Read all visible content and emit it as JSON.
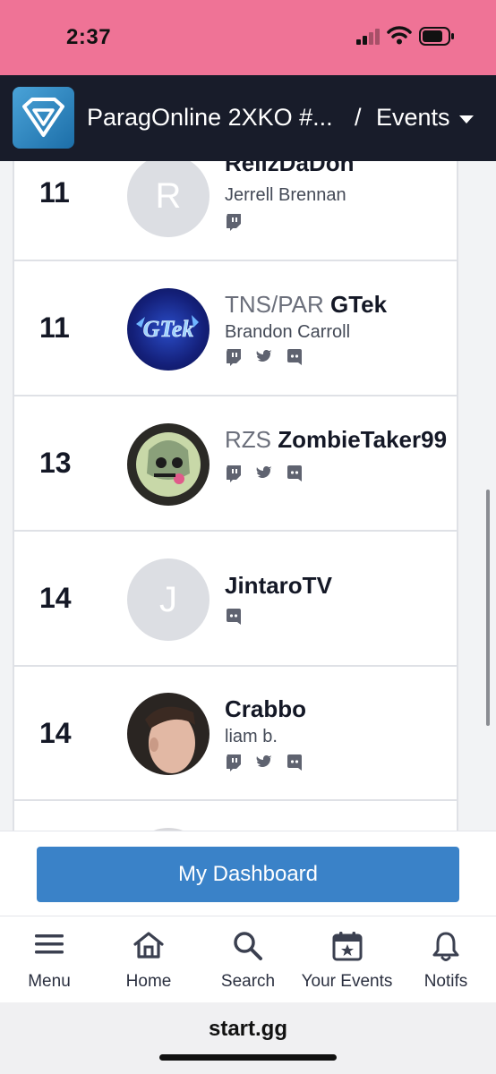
{
  "status_bar": {
    "time": "2:37"
  },
  "header": {
    "title": "ParagOnline 2XKO #...",
    "separator": "/",
    "section": "Events"
  },
  "entrants": [
    {
      "placement": "11",
      "prefix": "",
      "gamertag": "RellzDaDon",
      "name": "Jerrell Brennan",
      "avatar_letter": "R",
      "socials": [
        "twitch-icon"
      ]
    },
    {
      "placement": "11",
      "prefix": "TNS/PAR",
      "gamertag": "GTek",
      "name": "Brandon Carroll",
      "avatar_letter": "",
      "socials": [
        "twitch-icon",
        "twitter-icon",
        "discord-icon"
      ]
    },
    {
      "placement": "13",
      "prefix": "RZS",
      "gamertag": "ZombieTaker99",
      "name": "",
      "avatar_letter": "",
      "socials": [
        "twitch-icon",
        "twitter-icon",
        "discord-icon"
      ]
    },
    {
      "placement": "14",
      "prefix": "",
      "gamertag": "JintaroTV",
      "name": "",
      "avatar_letter": "J",
      "socials": [
        "discord-icon"
      ]
    },
    {
      "placement": "14",
      "prefix": "",
      "gamertag": "Crabbo",
      "name": "liam b.",
      "avatar_letter": "",
      "socials": [
        "twitch-icon",
        "twitter-icon",
        "discord-icon"
      ]
    }
  ],
  "dashboard_button": "My Dashboard",
  "bottom_nav": [
    {
      "label": "Menu",
      "icon": "menu-icon"
    },
    {
      "label": "Home",
      "icon": "home-icon"
    },
    {
      "label": "Search",
      "icon": "search-icon"
    },
    {
      "label": "Your Events",
      "icon": "calendar-star-icon"
    },
    {
      "label": "Notifs",
      "icon": "bell-icon"
    }
  ],
  "browser": {
    "url": "start.gg"
  },
  "colors": {
    "status_bar": "#ef7396",
    "header_bg": "#181c2a",
    "dashboard_button": "#3a82c8",
    "icon_gray": "#5f6370"
  }
}
